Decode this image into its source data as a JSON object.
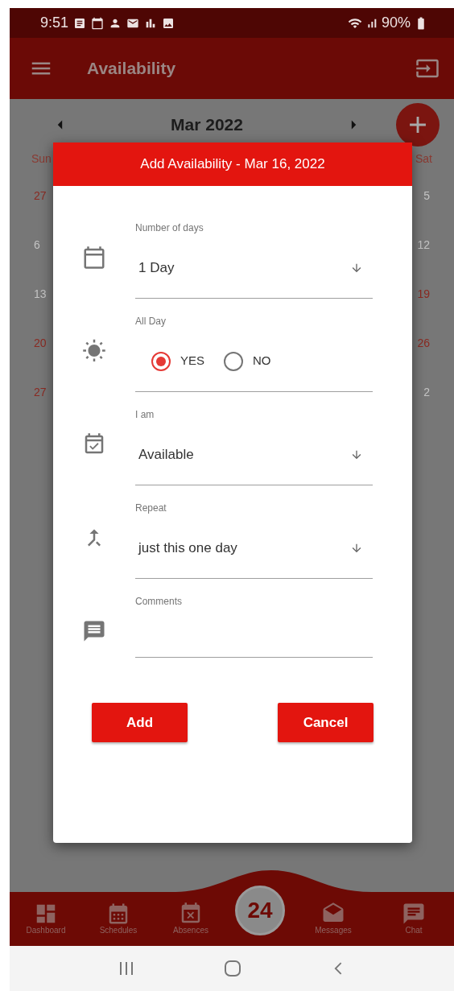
{
  "status_bar": {
    "time": "9:51",
    "battery": "90%"
  },
  "app_bar": {
    "title": "Availability"
  },
  "calendar": {
    "month": "Mar 2022",
    "weekdays": [
      "Sun",
      "Sat"
    ],
    "left_days": [
      {
        "day": "27",
        "muted": false
      },
      {
        "day": "6",
        "muted": true
      },
      {
        "day": "13",
        "muted": true
      },
      {
        "day": "20",
        "muted": false
      },
      {
        "day": "27",
        "muted": false
      }
    ],
    "right_days": [
      {
        "day": "5",
        "muted": true
      },
      {
        "day": "12",
        "muted": true
      },
      {
        "day": "19",
        "muted": false
      },
      {
        "day": "26",
        "muted": false
      },
      {
        "day": "2",
        "muted": true
      }
    ]
  },
  "dialog": {
    "title": "Add Availability - Mar 16, 2022",
    "fields": [
      {
        "kind": "select",
        "label": "Number of days",
        "value": "1 Day"
      },
      {
        "kind": "radio",
        "label": "All Day",
        "options": [
          {
            "label": "YES",
            "selected": true
          },
          {
            "label": "NO",
            "selected": false
          }
        ]
      },
      {
        "kind": "select",
        "label": "I am",
        "value": "Available"
      },
      {
        "kind": "select",
        "label": "Repeat",
        "value": "just this one day"
      },
      {
        "kind": "textarea",
        "label": "Comments"
      }
    ],
    "buttons": [
      "Add",
      "Cancel"
    ]
  },
  "bottom_nav": {
    "left": [
      {
        "label": "Dashboard"
      },
      {
        "label": "Schedules"
      },
      {
        "label": "Absences"
      }
    ],
    "center": "24",
    "right": [
      {
        "label": "Messages"
      },
      {
        "label": "Chat"
      }
    ]
  }
}
